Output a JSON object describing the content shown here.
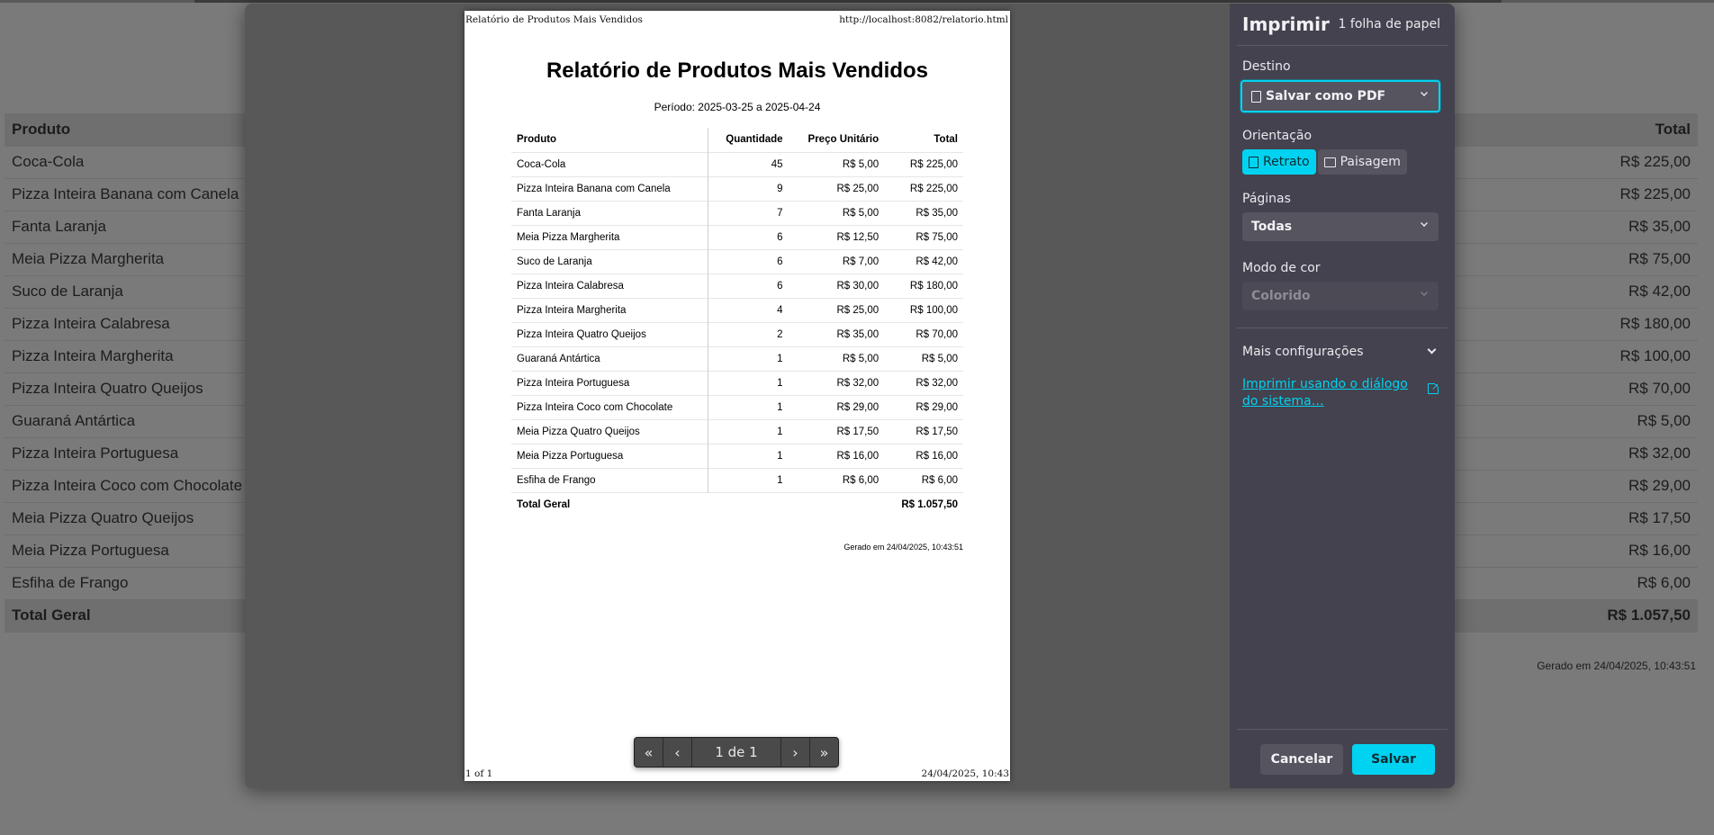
{
  "background": {
    "headers": [
      "Produto",
      "Total"
    ],
    "rows": [
      [
        "Coca-Cola",
        "R$ 225,00"
      ],
      [
        "Pizza Inteira Banana com Canela",
        "R$ 225,00"
      ],
      [
        "Fanta Laranja",
        "R$ 35,00"
      ],
      [
        "Meia Pizza Margherita",
        "R$ 75,00"
      ],
      [
        "Suco de Laranja",
        "R$ 42,00"
      ],
      [
        "Pizza Inteira Calabresa",
        "R$ 180,00"
      ],
      [
        "Pizza Inteira Margherita",
        "R$ 100,00"
      ],
      [
        "Pizza Inteira Quatro Queijos",
        "R$ 70,00"
      ],
      [
        "Guaraná Antártica",
        "R$ 5,00"
      ],
      [
        "Pizza Inteira Portuguesa",
        "R$ 32,00"
      ],
      [
        "Pizza Inteira Coco com Chocolate",
        "R$ 29,00"
      ],
      [
        "Meia Pizza Quatro Queijos",
        "R$ 17,50"
      ],
      [
        "Meia Pizza Portuguesa",
        "R$ 16,00"
      ],
      [
        "Esfiha de Frango",
        "R$ 6,00"
      ]
    ],
    "total_label": "Total Geral",
    "total_value": "R$ 1.057,50",
    "generated": "Gerado em 24/04/2025, 10:43:51"
  },
  "preview": {
    "header_left": "Relatório de Produtos Mais Vendidos",
    "header_right": "http://localhost:8082/relatorio.html",
    "footer_left": "1 of 1",
    "footer_right": "24/04/2025, 10:43",
    "title": "Relatório de Produtos Mais Vendidos",
    "period": "Período: 2025-03-25 a 2025-04-24",
    "columns": [
      "Produto",
      "Quantidade",
      "Preço Unitário",
      "Total"
    ],
    "rows": [
      [
        "Coca-Cola",
        "45",
        "R$ 5,00",
        "R$ 225,00"
      ],
      [
        "Pizza Inteira Banana com Canela",
        "9",
        "R$ 25,00",
        "R$ 225,00"
      ],
      [
        "Fanta Laranja",
        "7",
        "R$ 5,00",
        "R$ 35,00"
      ],
      [
        "Meia Pizza Margherita",
        "6",
        "R$ 12,50",
        "R$ 75,00"
      ],
      [
        "Suco de Laranja",
        "6",
        "R$ 7,00",
        "R$ 42,00"
      ],
      [
        "Pizza Inteira Calabresa",
        "6",
        "R$ 30,00",
        "R$ 180,00"
      ],
      [
        "Pizza Inteira Margherita",
        "4",
        "R$ 25,00",
        "R$ 100,00"
      ],
      [
        "Pizza Inteira Quatro Queijos",
        "2",
        "R$ 35,00",
        "R$ 70,00"
      ],
      [
        "Guaraná Antártica",
        "1",
        "R$ 5,00",
        "R$ 5,00"
      ],
      [
        "Pizza Inteira Portuguesa",
        "1",
        "R$ 32,00",
        "R$ 32,00"
      ],
      [
        "Pizza Inteira Coco com Chocolate",
        "1",
        "R$ 29,00",
        "R$ 29,00"
      ],
      [
        "Meia Pizza Quatro Queijos",
        "1",
        "R$ 17,50",
        "R$ 17,50"
      ],
      [
        "Meia Pizza Portuguesa",
        "1",
        "R$ 16,00",
        "R$ 16,00"
      ],
      [
        "Esfiha de Frango",
        "1",
        "R$ 6,00",
        "R$ 6,00"
      ]
    ],
    "total_label": "Total Geral",
    "total_value": "R$ 1.057,50",
    "generated": "Gerado em 24/04/2025, 10:43:51",
    "pager": {
      "first": "«",
      "prev": "‹",
      "label": "1 de 1",
      "next": "›",
      "last": "»"
    }
  },
  "panel": {
    "title": "Imprimir",
    "sheets": "1 folha de papel",
    "destination_label": "Destino",
    "destination_value": "Salvar como PDF",
    "orientation_label": "Orientação",
    "orientation_portrait": "Retrato",
    "orientation_landscape": "Paisagem",
    "pages_label": "Páginas",
    "pages_value": "Todas",
    "color_label": "Modo de cor",
    "color_value": "Colorido",
    "more_settings": "Mais configurações",
    "system_dialog_link": "Imprimir usando o diálogo do sistema…",
    "cancel": "Cancelar",
    "save": "Salvar",
    "accent_color": "#00d3f1"
  }
}
